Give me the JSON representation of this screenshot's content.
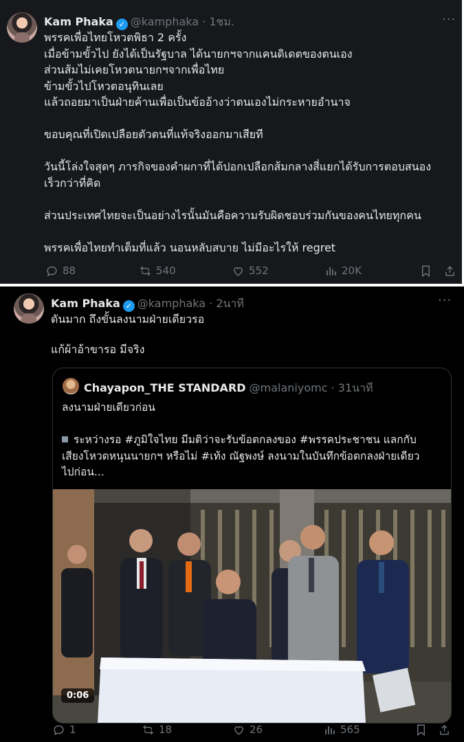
{
  "post1": {
    "name": "Kam Phaka",
    "handle_time": "@kamphaka · 1ชม.",
    "more": "···",
    "text": "พรรคเพื่อไทยโหวตพิธา 2 ครั้ง\nเมื่อข้ามขั้วไป ยังได้เป็นรัฐบาล ได้นายกฯจากแคนดิเดตของตนเอง\nส่วนส้มไม่เคยโหวตนายกฯจากเพื่อไทย\nข้ามขั้วไปโหวตอนุทินเลย\nแล้วถอยมาเป็นฝ่ายค้านเพื่อเป็นข้ออ้างว่าตนเองไม่กระหายอำนาจ\n\nขอบคุณที่เปิดเปลือยตัวตนที่แท้จริงออกมาเสียที\n\nวันนี้โล่งใจสุดๆ ภารกิจของคำผกาที่ได้ปอกเปลือกส้มกลางสี่แยกได้รับการตอบสนอง\nเร็วกว่าที่คิด\n\nส่วนประเทศไทยจะเป็นอย่างไรนั้นมันคือความรับผิดชอบร่วมกันของคนไทยทุกคน\n\nพรรคเพื่อไทยทำเต็มที่แล้ว นอนหลับสบาย ไม่มีอะไรให้ regret",
    "replies": "88",
    "reposts": "540",
    "likes": "552",
    "views": "20K"
  },
  "post2": {
    "name": "Kam Phaka",
    "handle_time": "@kamphaka · 2นาที",
    "more": "···",
    "text": "ดันมาก ถึงขั้นลงนามฝ่ายเดียวรอ\n\nแก้ผ้าอ้าขารอ มีจริง",
    "quote": {
      "name": "Chayapon_THE STANDARD",
      "handle_time": "@malaniyomc · 31นาที",
      "line1": "ลงนามฝ่ายเดียวก่อน",
      "body": "ระหว่างรอ #ภูมิใจไทย มีมติว่าจะรับข้อตกลงของ #พรรคประชาชน แลกกับ\nเสียงโหวตหนุนนายกฯ หรือไม่ #เท้ง ณัฐพงษ์ ลงนามในบันทึกข้อตกลงฝ่ายเดียว\nไปก่อน...",
      "video_time": "0:06"
    },
    "replies": "1",
    "reposts": "18",
    "likes": "26",
    "views": "565"
  },
  "colors": {
    "accent": "#1d9bf0",
    "muted": "#71767b",
    "text": "#e7e9ea"
  }
}
